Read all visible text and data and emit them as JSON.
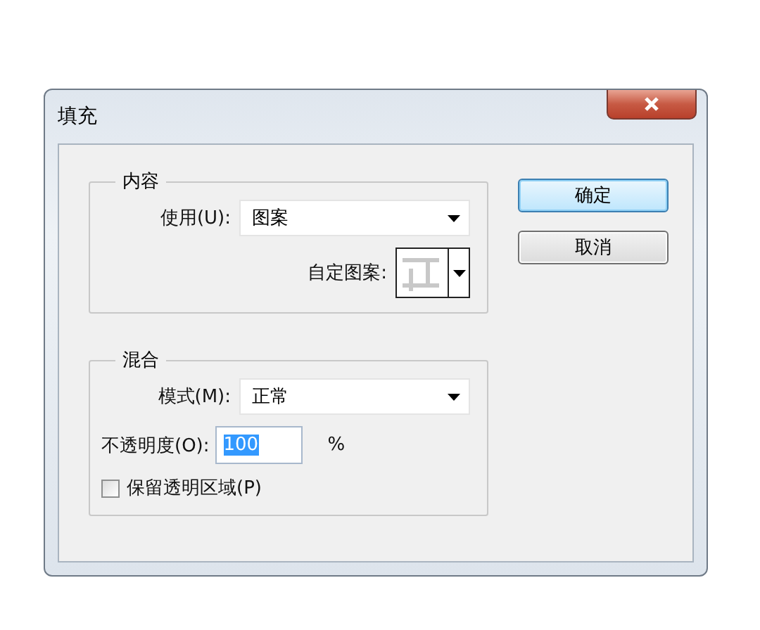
{
  "window": {
    "title": "填充"
  },
  "content_group": {
    "legend": "内容",
    "use": {
      "label": "使用(U):",
      "value": "图案"
    },
    "custom_pattern": {
      "label": "自定图案:"
    }
  },
  "blend_group": {
    "legend": "混合",
    "mode": {
      "label": "模式(M):",
      "value": "正常"
    },
    "opacity": {
      "label": "不透明度(O):",
      "value": "100",
      "text_selected": true,
      "unit": "%"
    },
    "preserve_transparency": {
      "label": "保留透明区域(P)",
      "checked": false
    }
  },
  "buttons": [
    {
      "label": "确定",
      "default": true
    },
    {
      "label": "取消",
      "default": false
    }
  ]
}
